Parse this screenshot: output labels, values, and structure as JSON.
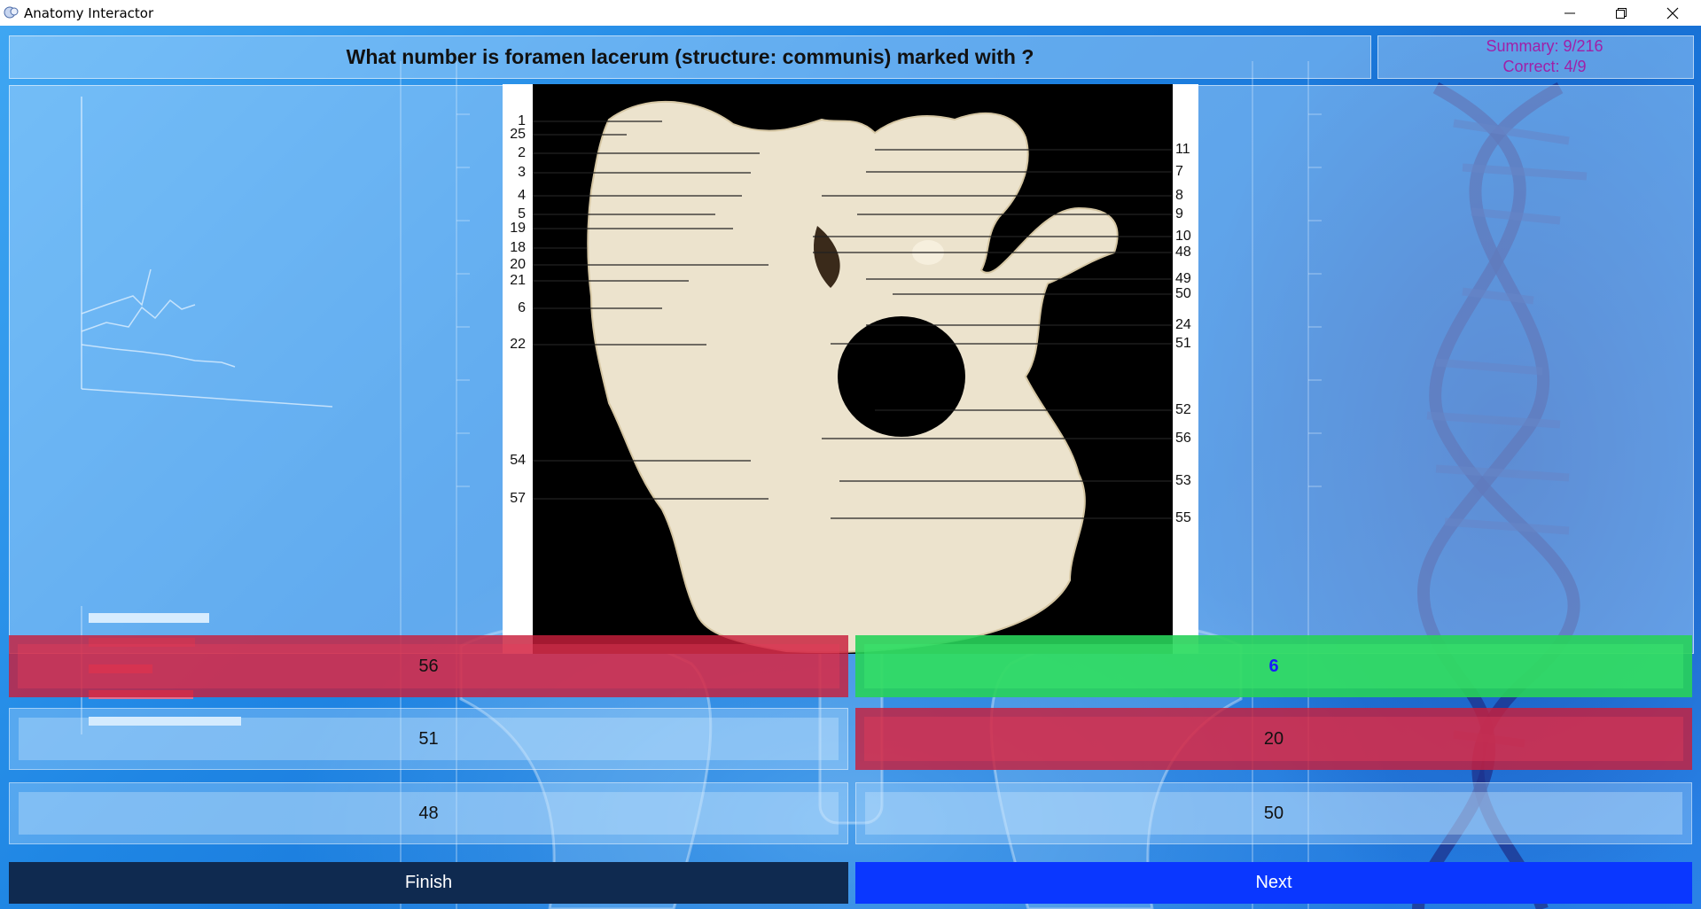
{
  "window": {
    "title": "Anatomy Interactor",
    "controls": [
      "minimize",
      "restore",
      "close"
    ]
  },
  "quiz": {
    "question": "What number is foramen lacerum (structure: communis) marked with ?",
    "summary": "Summary: 9/216",
    "correct": "Correct: 4/9"
  },
  "figure": {
    "left_labels": [
      "1",
      "25",
      "2",
      "3",
      "4",
      "5",
      "19",
      "18",
      "20",
      "21",
      "6",
      "22",
      "54",
      "57"
    ],
    "right_labels": [
      "11",
      "7",
      "8",
      "9",
      "10",
      "48",
      "49",
      "50",
      "24",
      "51",
      "52",
      "56",
      "53",
      "55"
    ]
  },
  "answers": [
    {
      "value": "56",
      "state": "wrong"
    },
    {
      "value": "6",
      "state": "correct"
    },
    {
      "value": "51",
      "state": "neutral"
    },
    {
      "value": "20",
      "state": "wrong"
    },
    {
      "value": "48",
      "state": "neutral"
    },
    {
      "value": "50",
      "state": "neutral"
    }
  ],
  "buttons": {
    "finish": "Finish",
    "next": "Next"
  },
  "colors": {
    "background": "#1f86e4",
    "wrong": "#c81e3c",
    "correct": "#28d25a",
    "next": "#0a37ff",
    "finish": "#0f2a50",
    "score": "#a020a8"
  }
}
